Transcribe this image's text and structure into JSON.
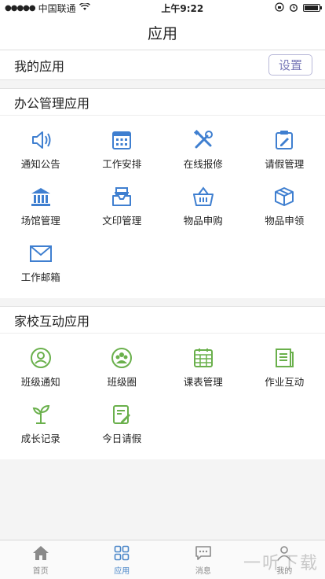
{
  "status_bar": {
    "carrier": "中国联通",
    "time": "上午9:22"
  },
  "nav": {
    "title": "应用"
  },
  "my_apps": {
    "title": "我的应用",
    "settings_label": "设置"
  },
  "office": {
    "title": "办公管理应用",
    "items": [
      {
        "label": "通知公告",
        "icon": "speaker-icon"
      },
      {
        "label": "工作安排",
        "icon": "calendar-icon"
      },
      {
        "label": "在线报修",
        "icon": "tools-icon"
      },
      {
        "label": "请假管理",
        "icon": "leave-form-icon"
      },
      {
        "label": "场馆管理",
        "icon": "building-icon"
      },
      {
        "label": "文印管理",
        "icon": "tray-icon"
      },
      {
        "label": "物品申购",
        "icon": "basket-icon"
      },
      {
        "label": "物品申领",
        "icon": "box-icon"
      },
      {
        "label": "工作邮箱",
        "icon": "mail-icon"
      }
    ]
  },
  "home_school": {
    "title": "家校互动应用",
    "items": [
      {
        "label": "班级通知",
        "icon": "notice-icon"
      },
      {
        "label": "班级圈",
        "icon": "group-icon"
      },
      {
        "label": "课表管理",
        "icon": "timetable-icon"
      },
      {
        "label": "作业互动",
        "icon": "homework-icon"
      },
      {
        "label": "成长记录",
        "icon": "sprout-icon"
      },
      {
        "label": "今日请假",
        "icon": "leave-today-icon"
      }
    ]
  },
  "tabs": [
    {
      "label": "首页",
      "icon": "home-icon"
    },
    {
      "label": "应用",
      "icon": "apps-icon",
      "active": true
    },
    {
      "label": "消息",
      "icon": "message-icon"
    },
    {
      "label": "我的",
      "icon": "person-icon"
    }
  ],
  "watermark": "一听下载",
  "colors": {
    "blue": "#3f7fd0",
    "green": "#6ab04c",
    "tab_active": "#4a86c8"
  }
}
